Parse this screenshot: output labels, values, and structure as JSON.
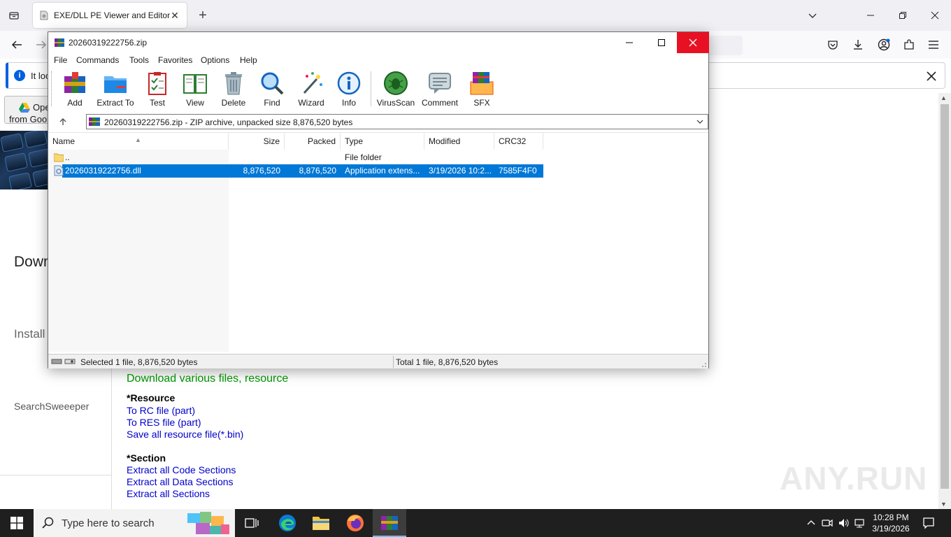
{
  "browser": {
    "tab": {
      "title": "EXE/DLL PE Viewer and Editor",
      "close": "✕"
    },
    "new_tab": "+",
    "notification": {
      "text": "It loo"
    },
    "left_pane": {
      "open_button_line1": "Ope",
      "open_button_line2": "from Goo",
      "heading": "Down",
      "install": "Install",
      "sweeper": "SearchSweeeper"
    },
    "main": {
      "download_heading": "Download various files, resource",
      "resource_heading": "*Resource",
      "resource_links": [
        "To RC file (part)",
        "To RES file (part)",
        "Save all resource file(*.bin)"
      ],
      "section_heading": "*Section",
      "section_links": [
        "Extract all Code Sections",
        "Extract all Data Sections",
        "Extract all Sections"
      ]
    },
    "watermark": "ANY.RUN"
  },
  "winrar": {
    "title": "20260319222756.zip",
    "menu": [
      "File",
      "Commands",
      "Tools",
      "Favorites",
      "Options",
      "Help"
    ],
    "toolbar": [
      {
        "label": "Add",
        "icon": "add-icon"
      },
      {
        "label": "Extract To",
        "icon": "extract-to-icon"
      },
      {
        "label": "Test",
        "icon": "test-icon"
      },
      {
        "label": "View",
        "icon": "view-icon"
      },
      {
        "label": "Delete",
        "icon": "delete-icon"
      },
      {
        "label": "Find",
        "icon": "find-icon"
      },
      {
        "label": "Wizard",
        "icon": "wizard-icon"
      },
      {
        "label": "Info",
        "icon": "info-icon"
      },
      {
        "label": "VirusScan",
        "icon": "virusscan-icon"
      },
      {
        "label": "Comment",
        "icon": "comment-icon"
      },
      {
        "label": "SFX",
        "icon": "sfx-icon"
      }
    ],
    "address": "20260319222756.zip - ZIP archive, unpacked size 8,876,520 bytes",
    "columns": {
      "name": "Name",
      "size": "Size",
      "packed": "Packed",
      "type": "Type",
      "modified": "Modified",
      "crc": "CRC32"
    },
    "rows": [
      {
        "name": "..",
        "size": "",
        "packed": "",
        "type": "File folder",
        "modified": "",
        "crc": "",
        "icon": "folder-icon",
        "selected": false
      },
      {
        "name": "20260319222756.dll",
        "size": "8,876,520",
        "packed": "8,876,520",
        "type": "Application extens...",
        "modified": "3/19/2026 10:2...",
        "crc": "7585F4F0",
        "icon": "dll-file-icon",
        "selected": true
      }
    ],
    "status_left": "Selected 1 file, 8,876,520 bytes",
    "status_right": "Total 1 file, 8,876,520 bytes"
  },
  "taskbar": {
    "search_placeholder": "Type here to search",
    "apps": [
      "task-view-icon",
      "edge-icon",
      "file-explorer-icon",
      "firefox-icon",
      "winrar-icon"
    ],
    "clock_time": "10:28 PM",
    "clock_date": "3/19/2026"
  },
  "colors": {
    "selection": "#0078d7",
    "close_red": "#e81123",
    "link": "#0000cc",
    "green_heading": "#009900",
    "taskbar": "#1f1f1f"
  }
}
